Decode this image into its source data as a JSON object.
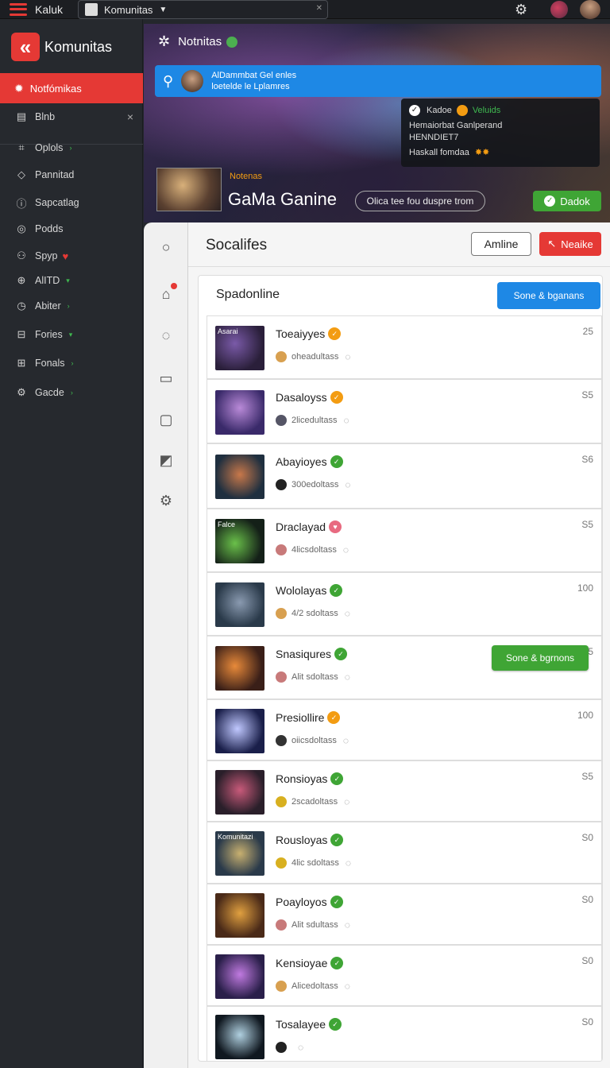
{
  "topbar": {
    "title": "Kaluk",
    "select_value": "Komunitas",
    "icons": [
      "menu-icon",
      "gear-icon"
    ]
  },
  "sidebar": {
    "brand": "Komunitas",
    "active_item": "Notfómikas",
    "items": [
      {
        "label": "Blnb",
        "icon": "book-icon"
      },
      {
        "label": "Oplols",
        "icon": "chart-icon"
      },
      {
        "label": "Pannitad",
        "icon": "layers-icon"
      },
      {
        "label": "Sapcatlag",
        "icon": "info-icon"
      },
      {
        "label": "Podds",
        "icon": "pin-icon"
      },
      {
        "label": "Spyp",
        "icon": "person-icon"
      },
      {
        "label": "AlITD",
        "icon": "globe-icon"
      },
      {
        "label": "Abiter",
        "icon": "clock-icon"
      },
      {
        "label": "Fories",
        "icon": "minus-box-icon"
      },
      {
        "label": "Fonals",
        "icon": "grid-icon"
      },
      {
        "label": "Gacde",
        "icon": "gear-icon"
      }
    ]
  },
  "hero": {
    "title": "Notnitas",
    "search_line1": "AlDammbat Gel enles",
    "search_line2": "loetelde le Lplamres",
    "popup": {
      "label": "Kadoe",
      "status": "Veluids",
      "line1": "Hemaiorbat Ganlperand",
      "line2": "HENNDIET7",
      "line3": "Haskall fomdaa"
    },
    "game_subtitle": "Notenas",
    "game_title": "GaMa Ganine",
    "pill": "Olica tee fou duspre trom",
    "button": "Dadok"
  },
  "main": {
    "title": "Socalifes",
    "btn_online": "Amline",
    "btn_red": "Neaike",
    "card_title": "Spadonline",
    "card_button": "Sone & bganans",
    "float_button": "Sone & bgrnons",
    "rows": [
      {
        "name": "Toeaiyyes",
        "sub": "oheadultass",
        "value": "25",
        "badge": "orange",
        "thumb_text": "Asarai"
      },
      {
        "name": "Dasaloyss",
        "sub": "2licedultass",
        "value": "S5",
        "badge": "orange",
        "thumb_text": ""
      },
      {
        "name": "Abayioyes",
        "sub": "300edoltass",
        "value": "S6",
        "badge": "green",
        "thumb_text": ""
      },
      {
        "name": "Draclayad",
        "sub": "4licsdoltass",
        "value": "S5",
        "badge": "pink",
        "thumb_text": "Falce"
      },
      {
        "name": "Wololayas",
        "sub": "4/2 sdoltass",
        "value": "100",
        "badge": "green",
        "thumb_text": ""
      },
      {
        "name": "Snasiqures",
        "sub": "Alit sdoltass",
        "value": "S5",
        "badge": "green",
        "thumb_text": ""
      },
      {
        "name": "Presiollire",
        "sub": "oiicsdoltass",
        "value": "100",
        "badge": "orange",
        "thumb_text": ""
      },
      {
        "name": "Ronsioyas",
        "sub": "2scadoltass",
        "value": "S5",
        "badge": "green",
        "thumb_text": ""
      },
      {
        "name": "Rousloyas",
        "sub": "4lic sdoltass",
        "value": "S0",
        "badge": "green",
        "thumb_text": "Komunitazi"
      },
      {
        "name": "Poayloyos",
        "sub": "Alit sdultass",
        "value": "S0",
        "badge": "green",
        "thumb_text": ""
      },
      {
        "name": "Kensioyae",
        "sub": "Alicedoltass",
        "value": "S0",
        "badge": "green",
        "thumb_text": ""
      },
      {
        "name": "Tosalayee",
        "sub": "",
        "value": "S0",
        "badge": "green",
        "thumb_text": ""
      }
    ]
  },
  "colors": {
    "accent_red": "#e53935",
    "accent_blue": "#1e88e5",
    "accent_green": "#3fa535",
    "badge_orange": "#f39c12"
  }
}
